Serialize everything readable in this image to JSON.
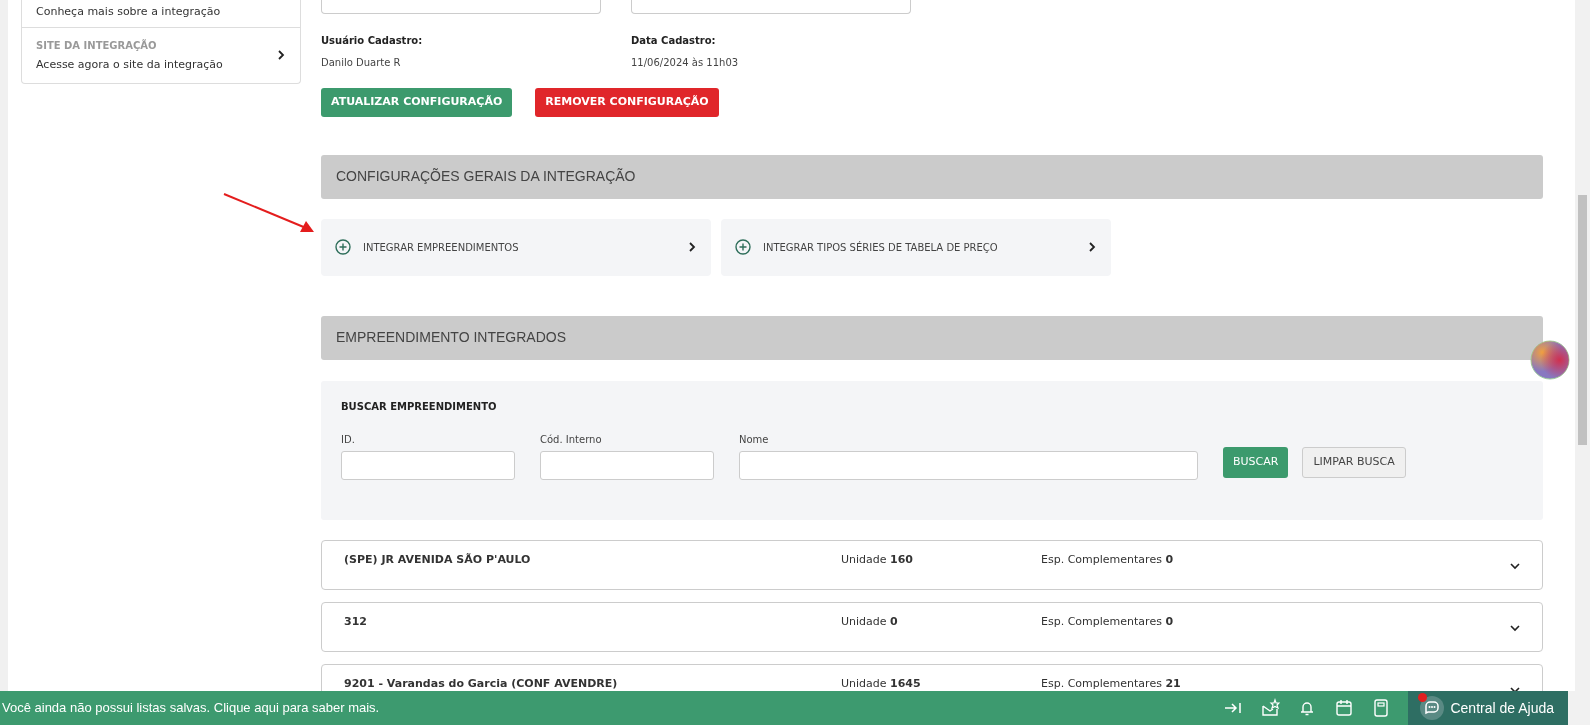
{
  "sidebar": {
    "items": [
      {
        "subtitle": "Conheça mais sobre a integração"
      },
      {
        "title": "SITE DA INTEGRAÇÃO",
        "subtitle": "Acesse agora o site da integração"
      }
    ]
  },
  "info": [
    {
      "label": "Usuário Cadastro:",
      "value": "Danilo Duarte R"
    },
    {
      "label": "Data Cadastro:",
      "value": "11/06/2024 às 11h03"
    }
  ],
  "actions": [
    {
      "label": "ATUALIZAR CONFIGURAÇÃO",
      "kind": "success"
    },
    {
      "label": "REMOVER CONFIGURAÇÃO",
      "kind": "danger"
    }
  ],
  "general_section": {
    "title": "CONFIGURAÇÕES GERAIS DA INTEGRAÇÃO",
    "options": [
      {
        "label": "INTEGRAR EMPREENDIMENTOS"
      },
      {
        "label": "INTEGRAR TIPOS SÉRIES DE TABELA DE PREÇO"
      }
    ]
  },
  "integrated_section": {
    "title": "EMPREENDIMENTO INTEGRADOS",
    "search": {
      "title": "BUSCAR EMPREENDIMENTO",
      "fields": [
        {
          "label": "ID."
        },
        {
          "label": "Cód. Interno"
        },
        {
          "label": "Nome"
        }
      ],
      "buttons": [
        {
          "label": "BUSCAR",
          "kind": "success"
        },
        {
          "label": "LIMPAR BUSCA",
          "kind": "light"
        }
      ]
    },
    "rows": [
      {
        "name": "(SPE) JR AVENIDA SÃO P'AULO",
        "unit_label": "Unidade",
        "units": "160",
        "extra_label": "Esp. Complementares",
        "extras": "0"
      },
      {
        "name": "312",
        "unit_label": "Unidade",
        "units": "0",
        "extra_label": "Esp. Complementares",
        "extras": "0"
      },
      {
        "name": "9201 - Varandas do Garcia (CONF AVENDRE)",
        "unit_label": "Unidade",
        "units": "1645",
        "extra_label": "Esp. Complementares",
        "extras": "21"
      }
    ]
  },
  "status_bar": {
    "message": "Você ainda não possui listas salvas. Clique aqui para saber mais.",
    "help": {
      "label": "Central de Ajuda",
      "notification": true
    }
  }
}
